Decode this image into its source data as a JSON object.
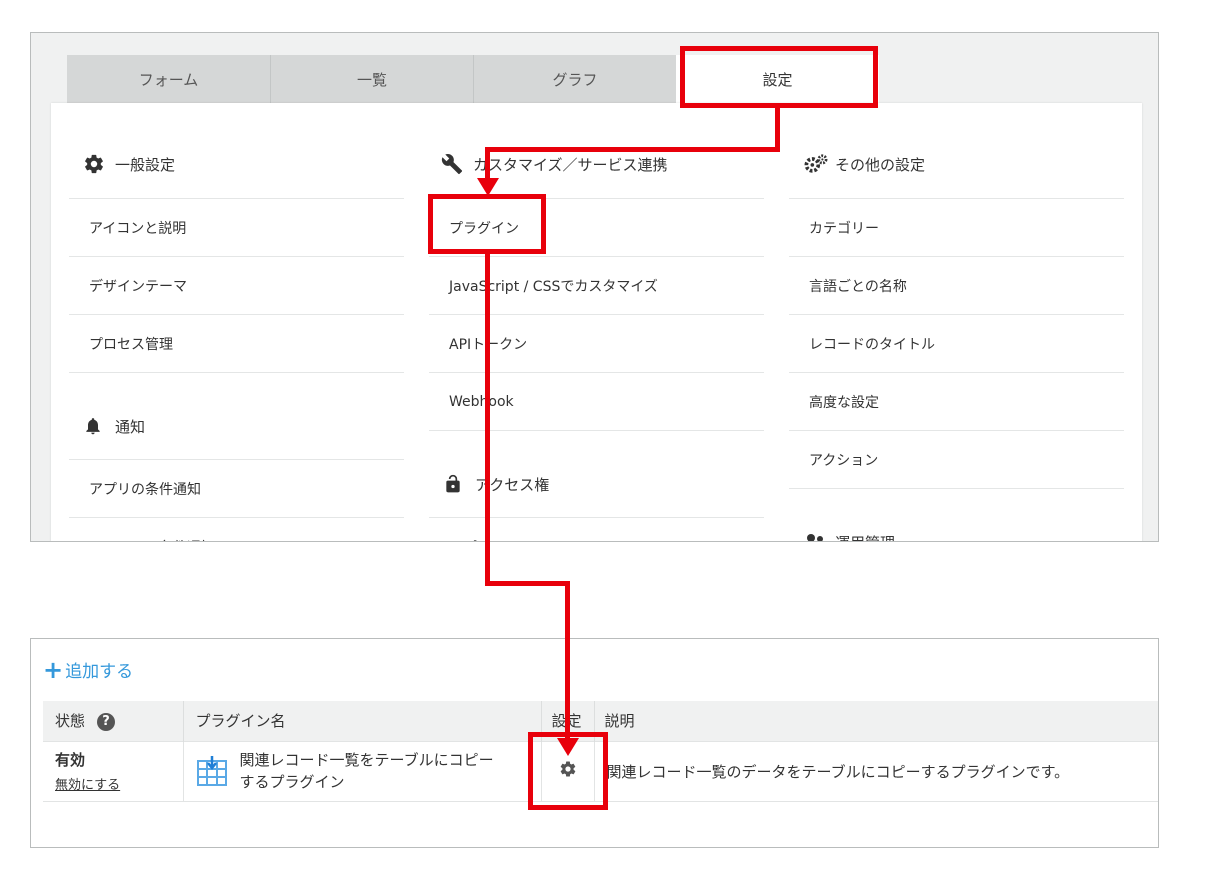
{
  "tabs": [
    {
      "label": "フォーム"
    },
    {
      "label": "一覧"
    },
    {
      "label": "グラフ"
    },
    {
      "label": "設定"
    }
  ],
  "general": {
    "title": "一般設定",
    "items": [
      "アイコンと説明",
      "デザインテーマ",
      "プロセス管理"
    ]
  },
  "notify": {
    "title": "通知",
    "items": [
      "アプリの条件通知",
      "レコードの条件通知"
    ]
  },
  "customize": {
    "title": "カスタマイズ／サービス連携",
    "items": [
      "プラグイン",
      "JavaScript / CSSでカスタマイズ",
      "APIトークン",
      "Webhook"
    ]
  },
  "access": {
    "title": "アクセス権",
    "items": [
      "アプリ"
    ]
  },
  "other": {
    "title": "その他の設定",
    "items": [
      "カテゴリー",
      "言語ごとの名称",
      "レコードのタイトル",
      "高度な設定",
      "アクション"
    ]
  },
  "ops": {
    "title": "運用管理"
  },
  "plugins": {
    "add_label": "追加する",
    "headers": {
      "status": "状態",
      "name": "プラグイン名",
      "settings": "設定",
      "description": "説明"
    },
    "rows": [
      {
        "status": "有効",
        "toggle": "無効にする",
        "name": "関連レコード一覧をテーブルにコピー\nするプラグイン",
        "description": "関連レコード一覧のデータをテーブルにコピーするプラグインです。"
      }
    ]
  },
  "colors": {
    "annotation": "#e8000b",
    "link": "#3498db",
    "plugin_icon": "#5aa9e6"
  }
}
